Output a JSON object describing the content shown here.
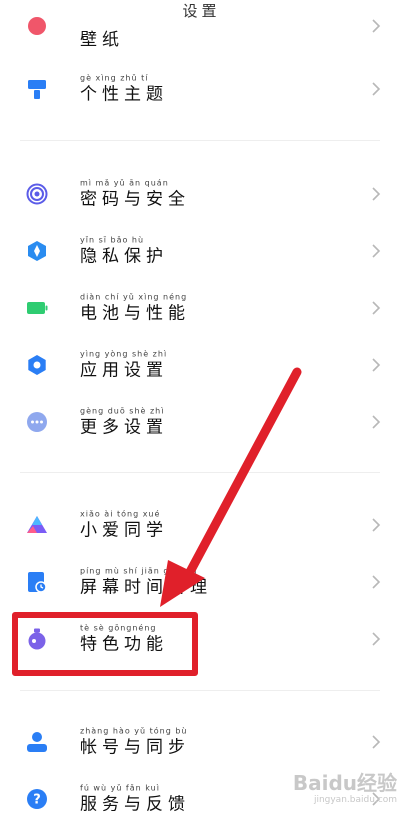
{
  "header": {
    "title": "设置"
  },
  "rows": [
    {
      "id": "wallpaper",
      "pinyin": "",
      "hanzi": "壁纸",
      "color": "#f0566a",
      "icon": "wallpaper-icon"
    },
    {
      "id": "theme",
      "pinyin": "gè xìng zhǔ tí",
      "hanzi": "个性主题",
      "color": "#2a7ef5",
      "icon": "paint-brush-icon"
    },
    {
      "id": "password",
      "pinyin": "mì mǎ yǔ ān quán",
      "hanzi": "密码与安全",
      "color": "#5b5ce8",
      "icon": "fingerprint-icon"
    },
    {
      "id": "privacy",
      "pinyin": "yǐn sī bǎo hù",
      "hanzi": "隐私保护",
      "color": "#2a8cf0",
      "icon": "privacy-shield-icon"
    },
    {
      "id": "battery",
      "pinyin": "diàn chí yǔ xìng néng",
      "hanzi": "电池与性能",
      "color": "#2ecc71",
      "icon": "battery-icon"
    },
    {
      "id": "apps",
      "pinyin": "yìng yòng shè zhì",
      "hanzi": "应用设置",
      "color": "#2a7ef5",
      "icon": "gear-icon"
    },
    {
      "id": "more",
      "pinyin": "gèng duō shè zhì",
      "hanzi": "更多设置",
      "color": "#8fa8ee",
      "icon": "more-dots-icon"
    },
    {
      "id": "xiaoai",
      "pinyin": "xiǎo ài tóng xué",
      "hanzi": "小爱同学",
      "color": "#7b5cf5",
      "icon": "xiaoai-icon"
    },
    {
      "id": "screentime",
      "pinyin": "píng mù shí jiān guǎn lǐ",
      "hanzi": "屏幕时间管理",
      "color": "#2a7ef5",
      "icon": "hourglass-icon"
    },
    {
      "id": "special",
      "pinyin": "tè sè gōngnéng",
      "hanzi": "特色功能",
      "color": "#7b62e8",
      "icon": "flask-icon"
    },
    {
      "id": "account",
      "pinyin": "zhàng hào yǔ tóng bù",
      "hanzi": "帐号与同步",
      "color": "#2a7ef5",
      "icon": "user-icon"
    },
    {
      "id": "feedback",
      "pinyin": "fú wù yǔ fǎn kuì",
      "hanzi": "服务与反馈",
      "color": "#2a7ef5",
      "icon": "help-icon"
    }
  ],
  "annotation": {
    "color": "#e0202a"
  },
  "watermark": {
    "main": "Baidu经验",
    "sub": "jingyan.baidu.com"
  }
}
